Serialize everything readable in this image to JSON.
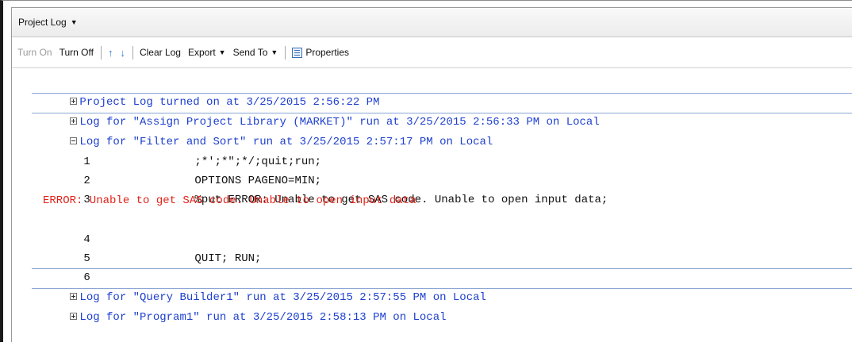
{
  "panel": {
    "title": "Project Log"
  },
  "toolbar": {
    "turn_on": "Turn On",
    "turn_off": "Turn Off",
    "clear_log": "Clear Log",
    "export": "Export",
    "send_to": "Send To",
    "properties": "Properties"
  },
  "log": {
    "nodes": [
      {
        "expanded": false,
        "text": "Project Log turned on at 3/25/2015 2:56:22 PM"
      },
      {
        "expanded": false,
        "text": "Log for \"Assign Project Library (MARKET)\" run at 3/25/2015 2:56:33 PM on Local"
      },
      {
        "expanded": true,
        "text": "Log for \"Filter and Sort\" run at 3/25/2015 2:57:17 PM on Local"
      },
      {
        "expanded": false,
        "text": "Log for \"Query Builder1\" run at 3/25/2015 2:57:55 PM on Local"
      },
      {
        "expanded": false,
        "text": "Log for \"Program1\" run at 3/25/2015 2:58:13 PM on Local"
      }
    ],
    "code_lines": [
      {
        "num": "1",
        "code": ";*';*\";*/;quit;run;"
      },
      {
        "num": "2",
        "code": "OPTIONS PAGENO=MIN;"
      },
      {
        "num": "3",
        "code": "%put ERROR: Unable to get SAS code. Unable to open input data;"
      },
      {
        "num": "4",
        "code": ""
      },
      {
        "num": "5",
        "code": "QUIT; RUN;"
      },
      {
        "num": "6",
        "code": ""
      }
    ],
    "error_message": "ERROR: Unable to get SAS code. Unable to open input data"
  }
}
